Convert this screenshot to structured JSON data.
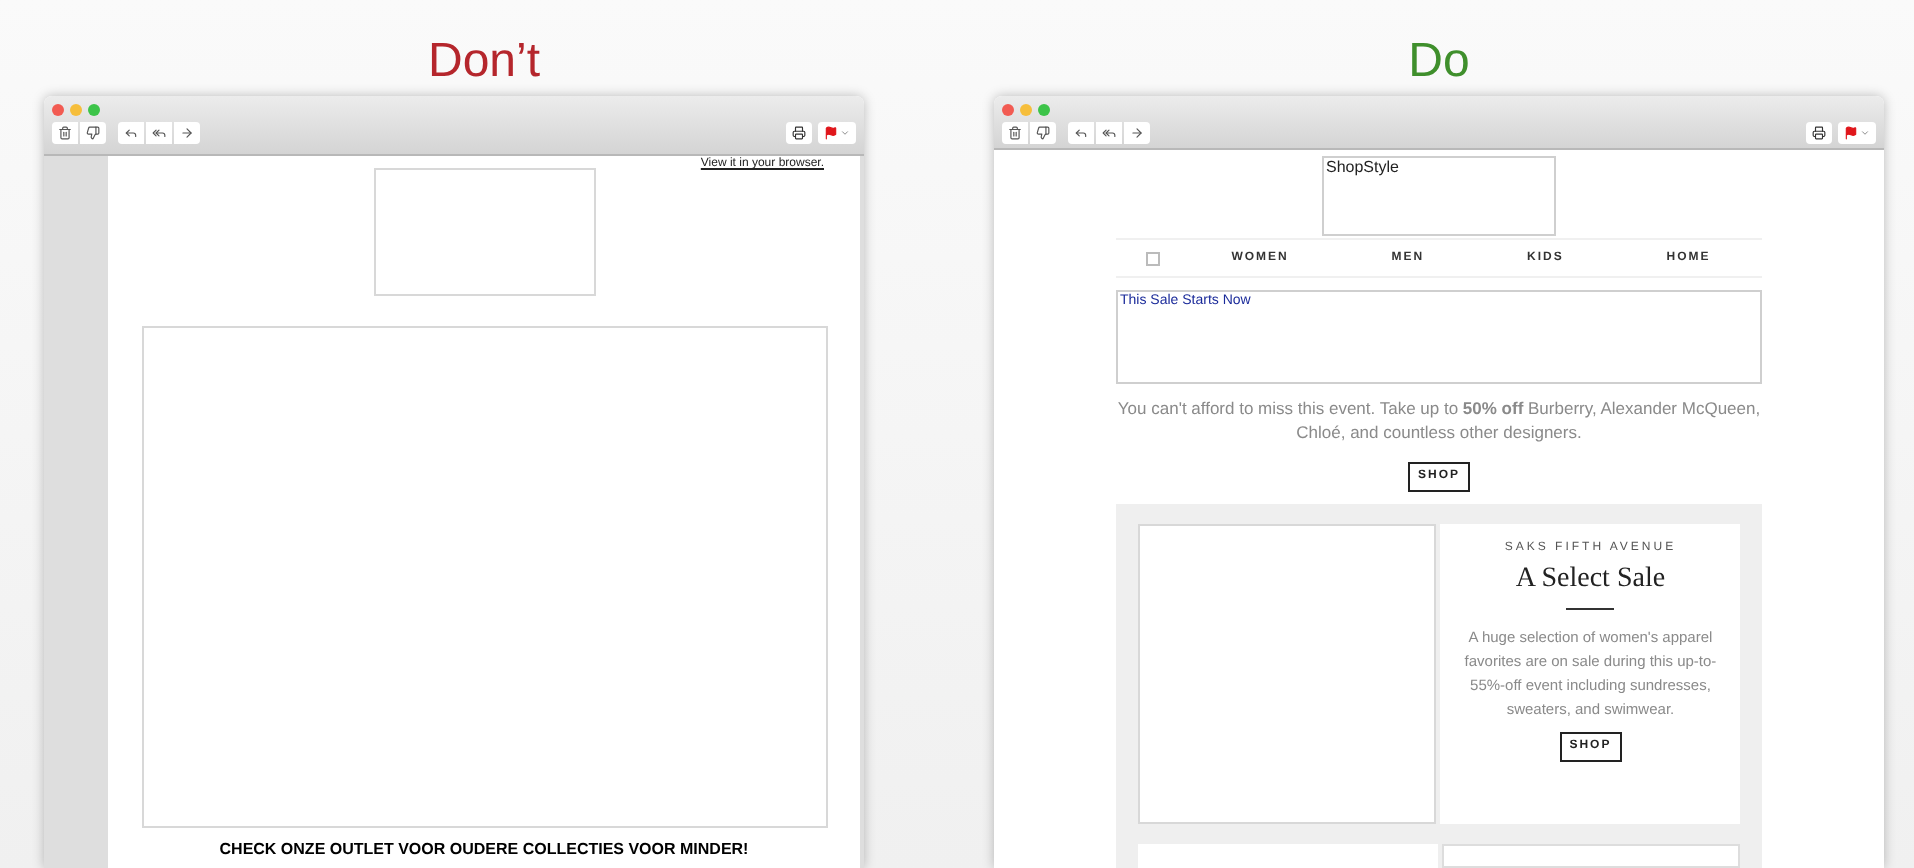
{
  "headings": [
    {
      "text": "Don’t",
      "kind": "bad"
    },
    {
      "text": "Do",
      "kind": "good"
    }
  ],
  "bad_email": {
    "browser_link": "View it in your browser.",
    "footer": "CHECK ONZE OUTLET VOOR OUDERE COLLECTIES VOOR MINDER!"
  },
  "good_email": {
    "logo_alt": "ShopStyle",
    "nav": [
      "WOMEN",
      "MEN",
      "KIDS",
      "HOME"
    ],
    "banner_alt": "This Sale Starts Now",
    "intro": "You can't afford to miss this event. Take up to **50% off** Burberry, Alexander McQueen, Chloé, and countless other designers.",
    "shop_button": "SHOP",
    "card": {
      "brand": "SAKS FIFTH AVENUE",
      "title": "A Select Sale",
      "body": "A huge selection of women's apparel favorites are on sale during this up-to-55%-off event including sundresses, sweaters, and swimwear.",
      "button": "SHOP"
    }
  }
}
